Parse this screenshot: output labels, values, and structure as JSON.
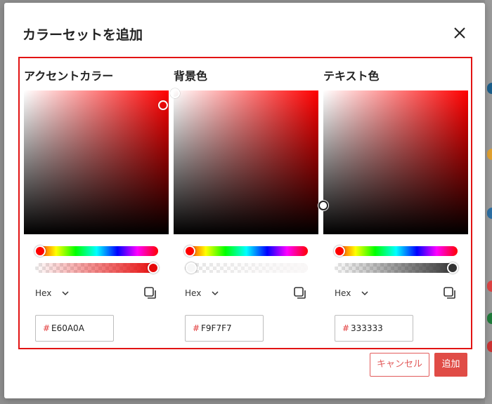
{
  "dialog": {
    "title": "カラーセットを追加",
    "close_icon": "close-icon"
  },
  "pickers": [
    {
      "title": "アクセントカラー",
      "hex": "E60A0A",
      "hue_color": "#ff0000",
      "base_color": "#e60a0a",
      "hue_position": 0.0,
      "alpha": 1.0,
      "saturation": 0.96,
      "value": 0.9
    },
    {
      "title": "背景色",
      "hex": "F9F7F7",
      "hue_color": "#ff0000",
      "base_color": "#f9f7f7",
      "hue_position": 0.0,
      "alpha": 0.0,
      "saturation": 0.01,
      "value": 0.98
    },
    {
      "title": "テキスト色",
      "hex": "333333",
      "hue_color": "#ff0000",
      "base_color": "#333333",
      "hue_position": 0.0,
      "alpha": 1.0,
      "saturation": 0.0,
      "value": 0.2
    }
  ],
  "format": {
    "label": "Hex",
    "chevron_icon": "chevron-down-icon",
    "copy_icon": "copy-icon",
    "hash": "#"
  },
  "buttons": {
    "cancel": "キャンセル",
    "add": "追加"
  },
  "colors": {
    "accent": "#e04c46",
    "frame": "#e21313"
  }
}
